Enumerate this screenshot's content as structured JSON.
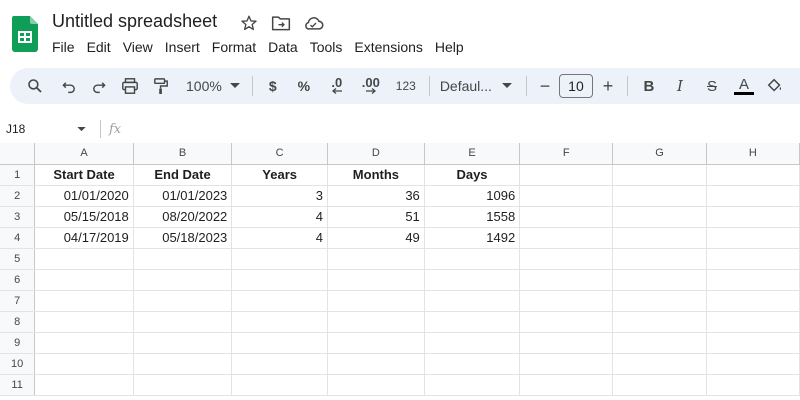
{
  "app": {
    "title": "Untitled spreadsheet",
    "brand_color": "#0f9d58"
  },
  "title_icons": [
    "star-icon",
    "move-folder-icon",
    "cloud-status-icon"
  ],
  "menu": [
    "File",
    "Edit",
    "View",
    "Insert",
    "Format",
    "Data",
    "Tools",
    "Extensions",
    "Help"
  ],
  "toolbar": {
    "zoom": "100%",
    "currency": "$",
    "percent": "%",
    "decrease_decimal": ".0",
    "increase_decimal": ".00",
    "more_formats": "123",
    "font": "Defaul...",
    "font_size": "10",
    "minus": "−",
    "plus": "+",
    "bold": "B",
    "italic": "I",
    "strike": "S",
    "text_color": "A"
  },
  "formula_bar": {
    "cell_ref": "J18",
    "fx": "fx",
    "value": ""
  },
  "grid": {
    "columns": [
      "A",
      "B",
      "C",
      "D",
      "E",
      "F",
      "G",
      "H"
    ],
    "rows": [
      {
        "num": "1",
        "cells": [
          "Start Date",
          "End Date",
          "Years",
          "Months",
          "Days",
          "",
          "",
          ""
        ]
      },
      {
        "num": "2",
        "cells": [
          "01/01/2020",
          "01/01/2023",
          "3",
          "36",
          "1096",
          "",
          "",
          ""
        ]
      },
      {
        "num": "3",
        "cells": [
          "05/15/2018",
          "08/20/2022",
          "4",
          "51",
          "1558",
          "",
          "",
          ""
        ]
      },
      {
        "num": "4",
        "cells": [
          "04/17/2019",
          "05/18/2023",
          "4",
          "49",
          "1492",
          "",
          "",
          ""
        ]
      },
      {
        "num": "5",
        "cells": [
          "",
          "",
          "",
          "",
          "",
          "",
          "",
          ""
        ]
      },
      {
        "num": "6",
        "cells": [
          "",
          "",
          "",
          "",
          "",
          "",
          "",
          ""
        ]
      },
      {
        "num": "7",
        "cells": [
          "",
          "",
          "",
          "",
          "",
          "",
          "",
          ""
        ]
      },
      {
        "num": "8",
        "cells": [
          "",
          "",
          "",
          "",
          "",
          "",
          "",
          ""
        ]
      },
      {
        "num": "9",
        "cells": [
          "",
          "",
          "",
          "",
          "",
          "",
          "",
          ""
        ]
      },
      {
        "num": "10",
        "cells": [
          "",
          "",
          "",
          "",
          "",
          "",
          "",
          ""
        ]
      },
      {
        "num": "11",
        "cells": [
          "",
          "",
          "",
          "",
          "",
          "",
          "",
          ""
        ]
      }
    ]
  }
}
